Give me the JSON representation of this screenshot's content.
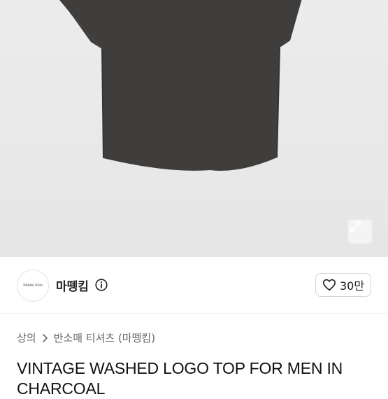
{
  "hero": {
    "expand_icon": "expand-arrows-icon",
    "shirt_color": "#3f3e3c"
  },
  "seller": {
    "avatar_text": "Mattie  Kim",
    "name": "마뗑킴",
    "info_icon": "info-circle-icon",
    "like_icon": "heart-outline-icon",
    "like_count": "30만"
  },
  "breadcrumb": {
    "level1": "상의",
    "separator_icon": "chevron-right-icon",
    "level2": "반소매 티셔츠 (마뗑킴)"
  },
  "product": {
    "title": "VINTAGE WASHED LOGO TOP FOR MEN IN CHARCOAL"
  }
}
